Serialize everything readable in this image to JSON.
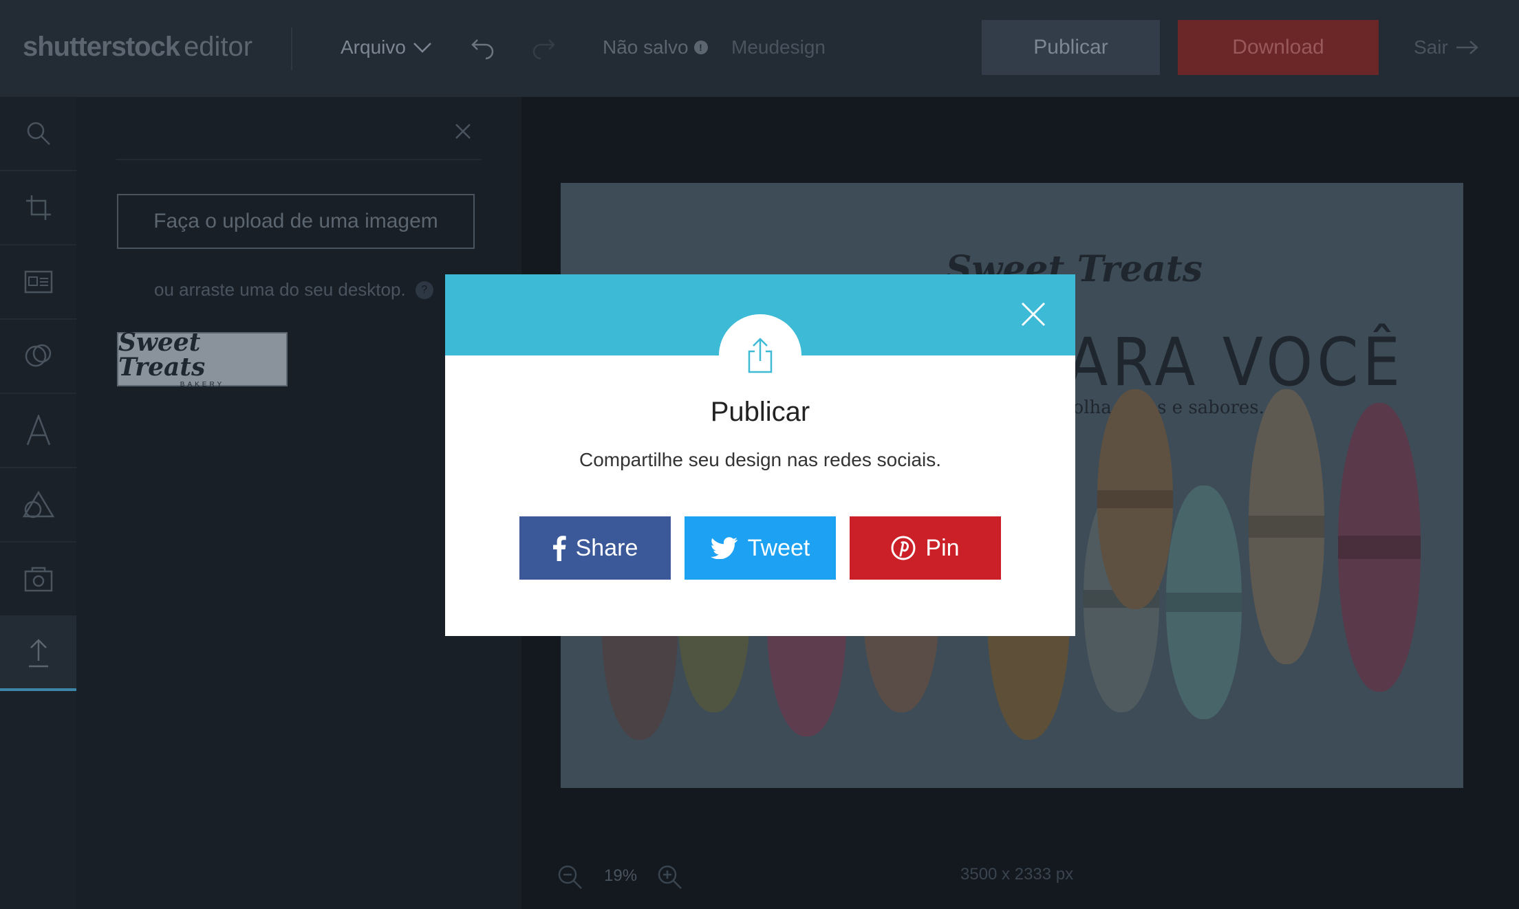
{
  "header": {
    "logo_main": "shutterstock",
    "logo_sub": "editor",
    "menu_file": "Arquivo",
    "save_status": "Não salvo",
    "save_info_glyph": "!",
    "design_name": "Meudesign",
    "publish_label": "Publicar",
    "download_label": "Download",
    "exit_label": "Sair"
  },
  "toolbar": {
    "items": [
      "search-icon",
      "crop-icon",
      "layout-icon",
      "color-icon",
      "text-icon",
      "shapes-icon",
      "background-icon",
      "upload-icon"
    ],
    "active": "upload-icon"
  },
  "panel": {
    "upload_button": "Faça o upload de uma imagem",
    "drag_hint": "ou arraste uma do seu desktop.",
    "help_glyph": "?",
    "thumb_script": "Sweet Treats",
    "thumb_sub": "BAKERY"
  },
  "artboard": {
    "script_title": "Sweet Treats",
    "headline": "S PARA VOCÊ",
    "subline": "colha cores e sabores."
  },
  "canvas_footer": {
    "zoom": "19%",
    "dimensions": "3500 x 2333 px"
  },
  "modal": {
    "title": "Publicar",
    "description": "Compartilhe seu design nas redes sociais.",
    "facebook_label": "Share",
    "twitter_label": "Tweet",
    "pinterest_label": "Pin"
  },
  "colors": {
    "modal_header": "#3dbad6",
    "facebook": "#3b5998",
    "twitter": "#1da1f2",
    "pinterest": "#cb2027"
  }
}
